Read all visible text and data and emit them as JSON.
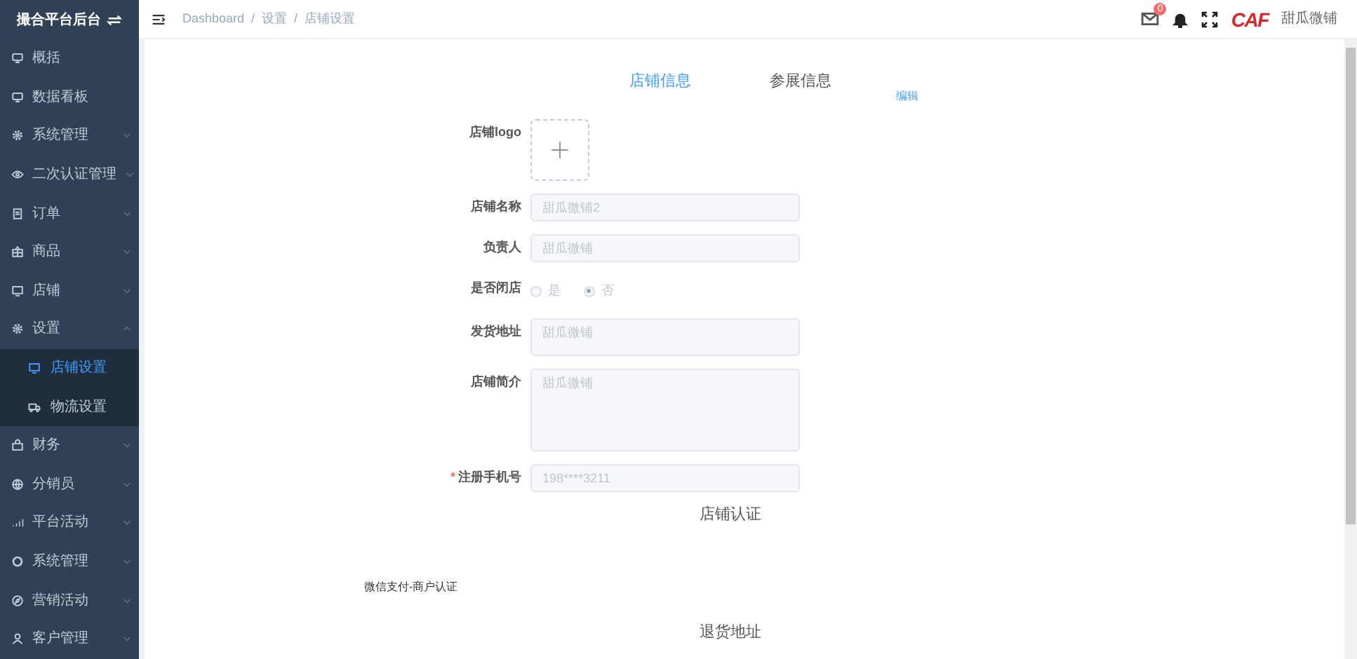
{
  "sidebar": {
    "title": "撮合平台后台",
    "items": [
      {
        "label": "概括",
        "kind": "link",
        "selected": false
      },
      {
        "label": "数据看板",
        "kind": "link",
        "selected": false
      },
      {
        "label": "系统管理",
        "kind": "group",
        "expanded": false,
        "selected": false
      },
      {
        "label": "二次认证管理",
        "kind": "group",
        "expanded": false,
        "selected": false
      },
      {
        "label": "订单",
        "kind": "group",
        "expanded": false,
        "selected": false
      },
      {
        "label": "商品",
        "kind": "group",
        "expanded": false,
        "selected": false
      },
      {
        "label": "店铺",
        "kind": "group",
        "expanded": false,
        "selected": false
      },
      {
        "label": "设置",
        "kind": "group",
        "expanded": true,
        "selected": false,
        "children": [
          {
            "label": "店铺设置",
            "selected": true
          },
          {
            "label": "物流设置",
            "selected": false
          }
        ]
      },
      {
        "label": "财务",
        "kind": "group",
        "expanded": false,
        "selected": false
      },
      {
        "label": "分销员",
        "kind": "group",
        "expanded": false,
        "selected": false
      },
      {
        "label": "平台活动",
        "kind": "group",
        "expanded": false,
        "selected": false
      },
      {
        "label": "系统管理",
        "kind": "group",
        "expanded": false,
        "selected": false
      },
      {
        "label": "营销活动",
        "kind": "group",
        "expanded": false,
        "selected": false
      },
      {
        "label": "客户管理",
        "kind": "group",
        "expanded": false,
        "selected": false
      }
    ]
  },
  "header": {
    "breadcrumbs": [
      "Dashboard",
      "设置",
      "店铺设置"
    ],
    "separator": "/",
    "mail_badge": "0",
    "logo": "CAF",
    "user": "甜瓜微铺"
  },
  "tabs": [
    {
      "label": "店铺信息",
      "selected": true
    },
    {
      "label": "参展信息",
      "selected": false
    }
  ],
  "edit_link": "编辑",
  "required_symbol": "*",
  "form": [
    {
      "kind": "upload",
      "label": "店铺logo",
      "required": false
    },
    {
      "kind": "input",
      "label": "店铺名称",
      "placeholder": "甜瓜微铺2",
      "required": false
    },
    {
      "kind": "input",
      "label": "负责人",
      "placeholder": "甜瓜微铺",
      "required": false
    },
    {
      "kind": "radio",
      "label": "是否闭店",
      "required": false,
      "options": [
        {
          "label": "是",
          "selected": false
        },
        {
          "label": "否",
          "selected": true
        }
      ]
    },
    {
      "kind": "textarea",
      "label": "发货地址",
      "placeholder": "甜瓜微铺",
      "required": false
    },
    {
      "kind": "longtext",
      "label": "店铺简介",
      "placeholder": "甜瓜微铺",
      "required": false
    },
    {
      "kind": "input",
      "label": "注册手机号",
      "placeholder": "198****3211",
      "required": true
    }
  ],
  "sections": [
    {
      "kind": "heading",
      "text": "店铺认证"
    },
    {
      "kind": "note",
      "text": "微信支付-商户认证"
    },
    {
      "kind": "heading",
      "text": "退货地址"
    }
  ]
}
